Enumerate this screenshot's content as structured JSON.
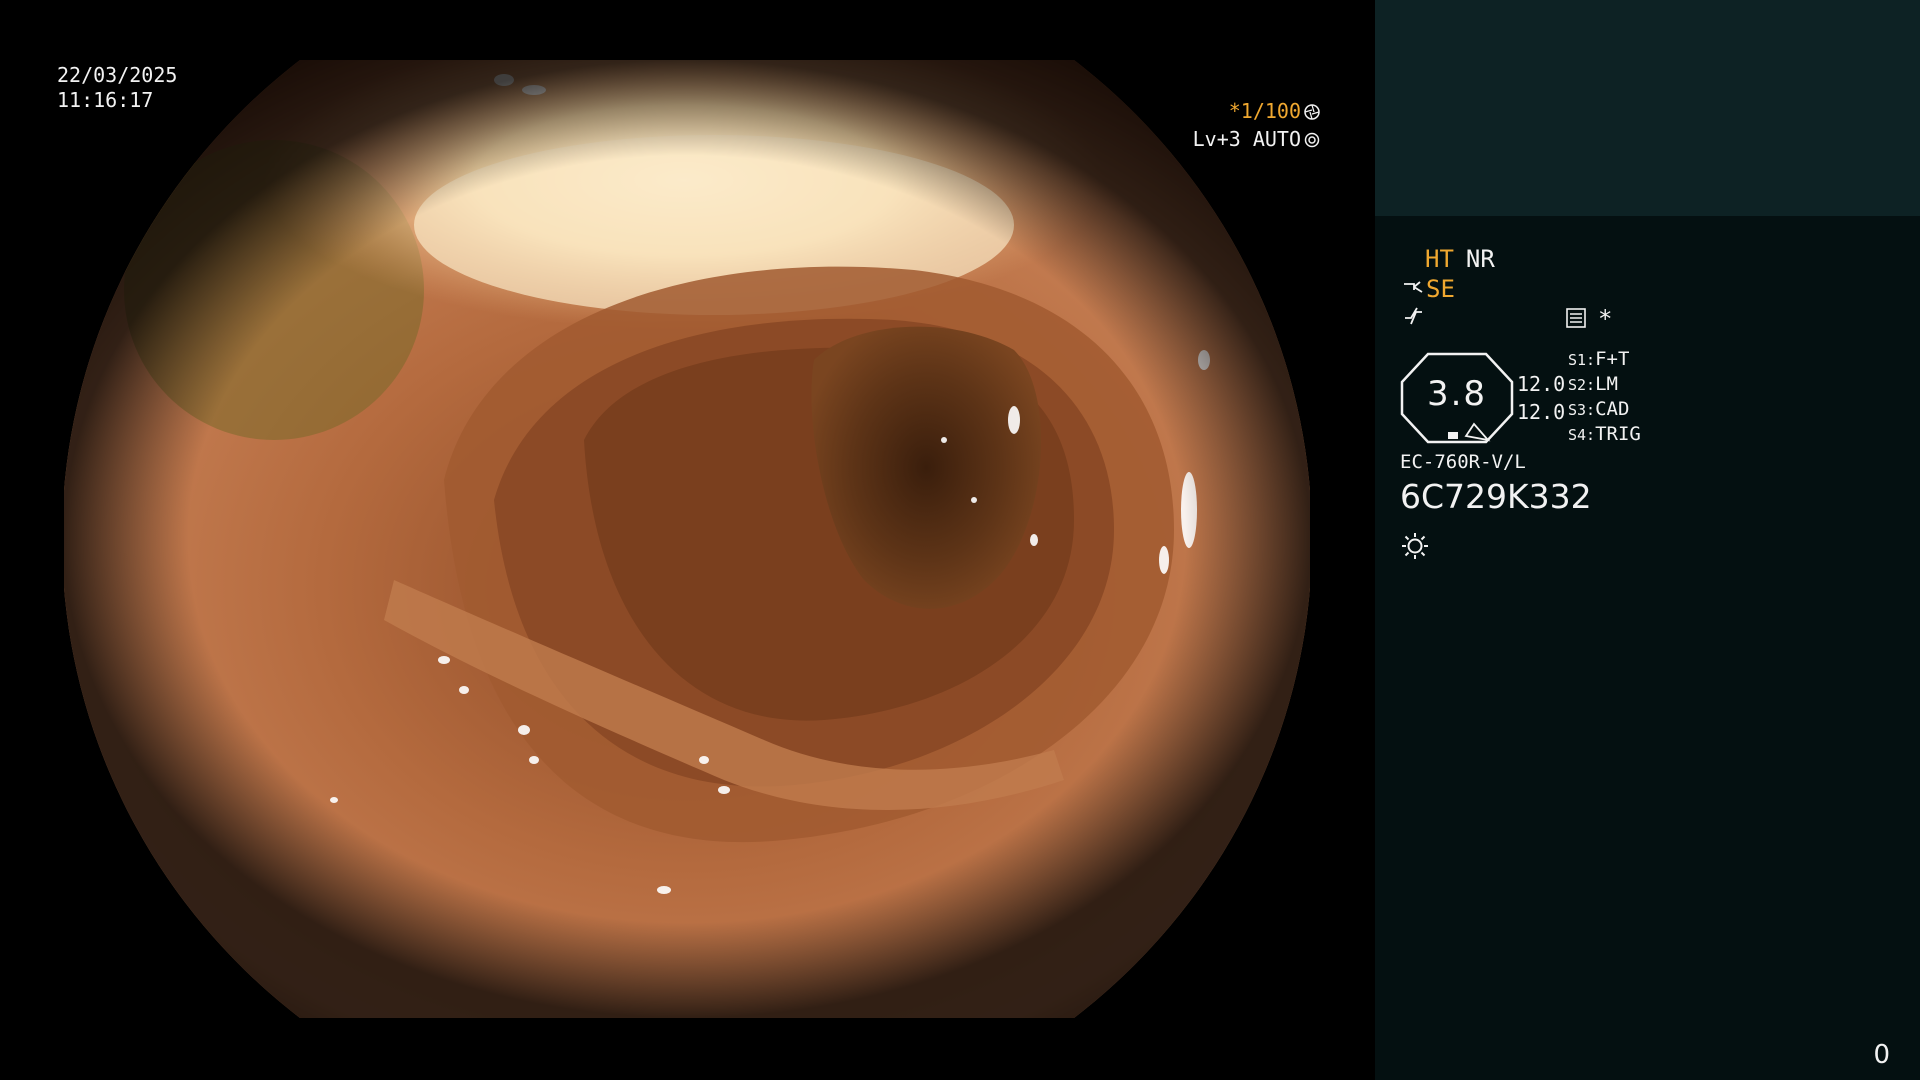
{
  "header": {
    "date": "22/03/2025",
    "time": "11:16:17",
    "shutter": "*1/100",
    "level": "Lv+3 AUTO"
  },
  "panel": {
    "mode_a": "HT",
    "mode_b": "NR",
    "enhance": "SE",
    "star": "*",
    "zoom": "3.8",
    "value_a": "12.0",
    "value_b": "12.0",
    "switches": [
      {
        "key": "S1:",
        "value": "F+T"
      },
      {
        "key": "S2:",
        "value": "LM"
      },
      {
        "key": "S3:",
        "value": "CAD"
      },
      {
        "key": "S4:",
        "value": "TRIG"
      }
    ],
    "scope_model": "EC-760R-V/L",
    "scope_serial": "6C729K332",
    "counter": "0"
  },
  "colors": {
    "osd_text": "#f2f2f2",
    "osd_accent": "#f0a830",
    "panel_top": "#0d2224",
    "panel_bottom": "#041011"
  },
  "icons": {
    "shutter_icon": "shutter-aperture-icon",
    "level_icon": "iris-gear-icon",
    "se_icon": "scope-tip-icon",
    "enhance_icon": "structure-enhance-icon",
    "memo_icon": "memo-icon",
    "light_icon": "light-source-icon"
  }
}
